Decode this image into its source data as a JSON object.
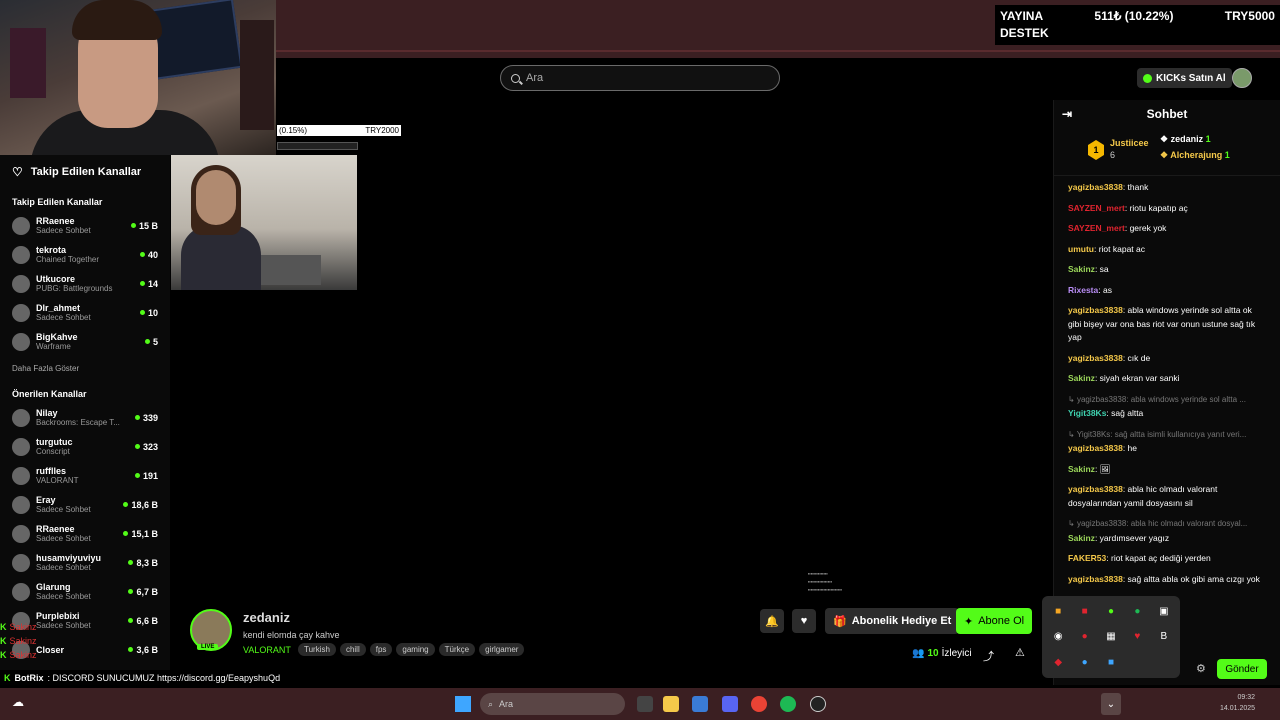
{
  "search": {
    "placeholder": "Ara"
  },
  "header": {
    "kicks_label": "KICKs Satın Al"
  },
  "donation": {
    "label_line1": "YAYINA",
    "label_line2": "DESTEK",
    "amount": "511₺ (10.22%)",
    "goal": "TRY5000"
  },
  "small_bar": {
    "percent": "(0.15%)",
    "goal": "TRY2000"
  },
  "sidebar": {
    "header": "Takip Edilen Kanallar",
    "followed_title": "Takip Edilen Kanallar",
    "followed": [
      {
        "name": "RRaenee",
        "category": "Sadece Sohbet",
        "viewers": "15 B"
      },
      {
        "name": "tekrota",
        "category": "Chained Together",
        "viewers": "40"
      },
      {
        "name": "Utkucore",
        "category": "PUBG: Battlegrounds",
        "viewers": "14"
      },
      {
        "name": "Dlr_ahmet",
        "category": "Sadece Sohbet",
        "viewers": "10"
      },
      {
        "name": "BigKahve",
        "category": "Warframe",
        "viewers": "5"
      }
    ],
    "more": "Daha Fazla Göster",
    "recommended_title": "Önerilen Kanallar",
    "recommended": [
      {
        "name": "Nilay",
        "category": "Backrooms: Escape T...",
        "viewers": "339"
      },
      {
        "name": "turgutuc",
        "category": "Conscript",
        "viewers": "323"
      },
      {
        "name": "rufflles",
        "category": "VALORANT",
        "viewers": "191"
      },
      {
        "name": "Eray",
        "category": "Sadece Sohbet",
        "viewers": "18,6 B"
      },
      {
        "name": "RRaenee",
        "category": "Sadece Sohbet",
        "viewers": "15,1 B"
      },
      {
        "name": "husamviyuviyu",
        "category": "Sadece Sohbet",
        "viewers": "8,3 B"
      },
      {
        "name": "Glarung",
        "category": "Sadece Sohbet",
        "viewers": "6,7 B"
      },
      {
        "name": "Purplebixi",
        "category": "Sadece Sohbet",
        "viewers": "6,6 B"
      },
      {
        "name": "Closer",
        "category": "",
        "viewers": "3,6 B"
      }
    ]
  },
  "stream": {
    "name": "zedaniz",
    "title": "kendi elomda çay kahve",
    "category": "VALORANT",
    "live": "LIVE",
    "tags": [
      "Turkish",
      "chill",
      "fps",
      "gaming",
      "Türkçe",
      "girlgamer"
    ],
    "gift_label": "Abonelik Hediye Et",
    "sub_label": "Abone Ol",
    "viewers_count": "10",
    "viewers_label": "İzleyici"
  },
  "overlay_chat": [
    {
      "user": "Sakinz"
    },
    {
      "user": "Sakinz"
    },
    {
      "user": "Sakinz"
    }
  ],
  "overlay_bot": {
    "user": "BotRix",
    "text": ": DISCORD SUNUCUMUZ https://discord.gg/EeapyshuQd"
  },
  "chat": {
    "title": "Sohbet",
    "leader": {
      "rank": "1",
      "user1": "Justiicee",
      "count1": "6",
      "user2": "zedaniz",
      "count2": "1",
      "user3": "Alcherajung",
      "count3": "1"
    },
    "messages": [
      {
        "user": "yagizbas3838",
        "color": "#f5c94a",
        "text": ": thank"
      },
      {
        "user": "SAYZEN_mert",
        "color": "#e0242f",
        "text": ": riotu kapatıp aç"
      },
      {
        "user": "SAYZEN_mert",
        "color": "#e0242f",
        "text": ": gerek yok"
      },
      {
        "user": "umutu",
        "color": "#f5c94a",
        "text": ": riot kapat ac"
      },
      {
        "user": "Sakinz",
        "color": "#9bd65a",
        "text": ": sa"
      },
      {
        "user": "Rixesta",
        "color": "#b98df5",
        "text": ": as"
      },
      {
        "user": "yagizbas3838",
        "color": "#f5c94a",
        "text": ": abla windows yerinde sol altta ok gibi bişey var ona bas riot var onun ustune sağ tık yap"
      },
      {
        "user": "yagizbas3838",
        "color": "#f5c94a",
        "text": ": cık de"
      },
      {
        "user": "Sakinz",
        "color": "#9bd65a",
        "text": ": siyah ekran var sanki"
      },
      {
        "reply": "yagizbas3838: abla windows yerinde sol altta ...",
        "user": "Yigit38Ks",
        "color": "#3fd3b0",
        "text": ": sağ altta"
      },
      {
        "reply": "Yigit38Ks: sağ altta isimli kullanıcıya yanıt veri...",
        "user": "yagizbas3838",
        "color": "#f5c94a",
        "text": ": he"
      },
      {
        "user": "Sakinz",
        "color": "#9bd65a",
        "text": ": 🖼"
      },
      {
        "user": "yagizbas3838",
        "color": "#f5c94a",
        "text": ": abla hic olmadı valorant dosyalarından yamil dosyasını sil"
      },
      {
        "reply": "yagizbas3838: abla hic olmadı valorant dosyal...",
        "user": "Sakinz",
        "color": "#9bd65a",
        "text": ": yardımsever yagız"
      },
      {
        "user": "FAKER53",
        "color": "#f5c94a",
        "text": ": riot kapat aç dediği yerden"
      },
      {
        "user": "yagizbas3838",
        "color": "#f5c94a",
        "text": ": sağ altta abla ok gibi ama cızgı yok"
      }
    ],
    "send_label": "Gönder"
  },
  "taskbar": {
    "search_placeholder": "Ara",
    "time": "09:32",
    "date": "14.01.2025"
  }
}
